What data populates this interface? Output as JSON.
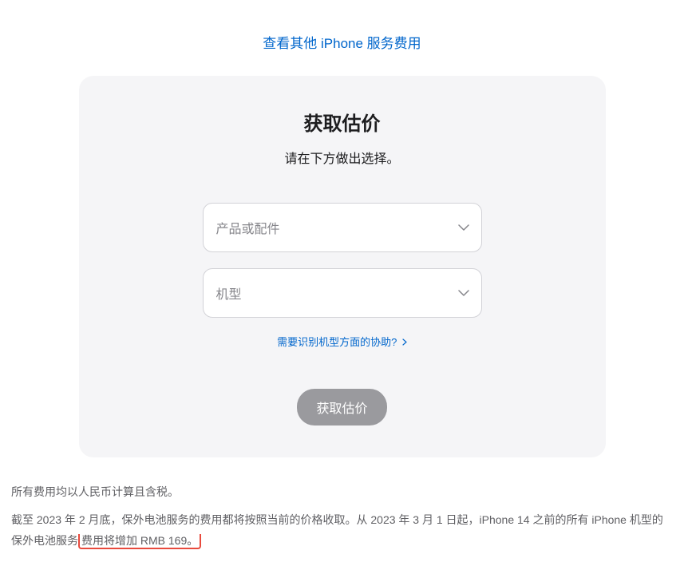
{
  "top_link": "查看其他 iPhone 服务费用",
  "card": {
    "title": "获取估价",
    "subtitle": "请在下方做出选择。",
    "select_product_placeholder": "产品或配件",
    "select_model_placeholder": "机型",
    "help_link": "需要识别机型方面的协助?",
    "submit_label": "获取估价"
  },
  "footnote1": "所有费用均以人民币计算且含税。",
  "footnote2_part1": "截至 2023 年 2 月底，保外电池服务的费用都将按照当前的价格收取。从 2023 年 3 月 1 日起，iPhone 14 之前的所有 iPhone 机型的保外电池服务",
  "footnote2_highlight": "费用将增加 RMB 169。"
}
